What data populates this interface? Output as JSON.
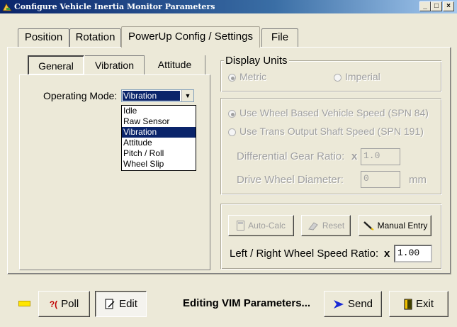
{
  "window": {
    "title": "Configure Vehicle Inertia Monitor Parameters"
  },
  "tabs": [
    {
      "label": "Position"
    },
    {
      "label": "Rotation"
    },
    {
      "label": "PowerUp Config / Settings"
    },
    {
      "label": "File"
    }
  ],
  "inner_tabs": [
    {
      "label": "General"
    },
    {
      "label": "Vibration"
    },
    {
      "label": "Attitude"
    }
  ],
  "general": {
    "operating_mode_label": "Operating Mode:",
    "operating_mode_value": "Vibration",
    "options": [
      "Idle",
      "Raw Sensor",
      "Vibration",
      "Attitude",
      "Pitch / Roll",
      "Wheel Slip"
    ]
  },
  "display_units": {
    "legend": "Display Units",
    "metric": "Metric",
    "imperial": "Imperial"
  },
  "speed": {
    "wheel_based": "Use Wheel Based Vehicle Speed (SPN 84)",
    "trans_output": "Use Trans Output Shaft Speed (SPN 191)",
    "gear_ratio_label": "Differential Gear Ratio:",
    "gear_ratio_x": "x",
    "gear_ratio_value": "1.0",
    "wheel_diameter_label": "Drive Wheel Diameter:",
    "wheel_diameter_value": "0",
    "wheel_diameter_unit": "mm"
  },
  "wheel_ratio": {
    "auto_calc": "Auto-Calc",
    "reset": "Reset",
    "manual_entry": "Manual Entry",
    "label": "Left / Right Wheel Speed Ratio:",
    "x": "x",
    "value": "1.00"
  },
  "bottom": {
    "poll": "Poll",
    "edit": "Edit",
    "status": "Editing VIM Parameters...",
    "send": "Send",
    "exit": "Exit"
  },
  "colors": {
    "title_bar": "#0a246a",
    "selection": "#0a246a",
    "indicator": "#ffe600",
    "send_arrow": "#1a2bd6"
  }
}
